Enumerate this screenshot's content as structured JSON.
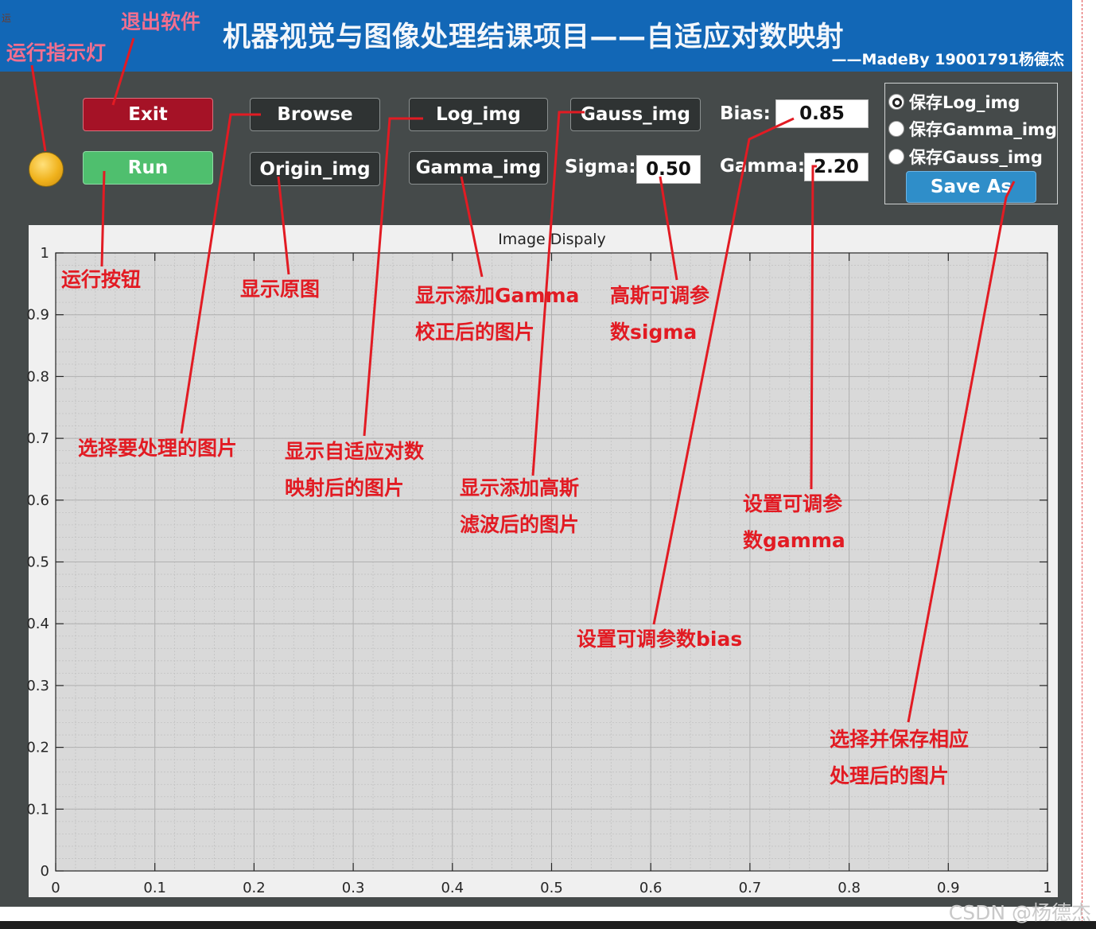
{
  "header": {
    "title": "机器视觉与图像处理结课项目——自适应对数映射",
    "made_by": "——MadeBy 19001791杨德杰",
    "edge_text": "运"
  },
  "controls": {
    "exit_label": "Exit",
    "run_label": "Run",
    "browse_label": "Browse",
    "origin_label": "Origin_img",
    "log_label": "Log_img",
    "gamma_label": "Gamma_img",
    "gauss_label": "Gauss_img",
    "bias_label": "Bias:",
    "bias_value": "0.85",
    "sigma_label": "Sigma:",
    "sigma_value": "0.50",
    "gamma_param_label": "Gamma:",
    "gamma_value": "2.20"
  },
  "save_panel": {
    "options": [
      "保存Log_img",
      "保存Gamma_img",
      "保存Gauss_img"
    ],
    "selected_index": 0,
    "save_label": "Save As"
  },
  "axes": {
    "title": "Image Dispaly",
    "x_ticks": [
      "0",
      "0.1",
      "0.2",
      "0.3",
      "0.4",
      "0.5",
      "0.6",
      "0.7",
      "0.8",
      "0.9",
      "1"
    ],
    "y_ticks": [
      "0",
      "0.1",
      "0.2",
      "0.3",
      "0.4",
      "0.5",
      "0.6",
      "0.7",
      "0.8",
      "0.9",
      "1"
    ],
    "xlim": [
      0,
      1
    ],
    "ylim": [
      0,
      1
    ],
    "grid": true,
    "minor_grid": true
  },
  "annotations": {
    "indicator": "运行指示灯",
    "exit": "退出软件",
    "run": "运行按钮",
    "origin": "显示原图",
    "gamma_line1": "显示添加Gamma",
    "gamma_line2": "校正后的图片",
    "sigma_line1": "高斯可调参",
    "sigma_line2": "数sigma",
    "browse": "选择要处理的图片",
    "log_line1": "显示自适应对数",
    "log_line2": "映射后的图片",
    "gauss_line1": "显示添加高斯",
    "gauss_line2": "滤波后的图片",
    "gammaparam_line1": "设置可调参",
    "gammaparam_line2": "数gamma",
    "bias": "设置可调参数bias",
    "save_line1": "选择并保存相应",
    "save_line2": "处理后的图片"
  },
  "colors": {
    "app_bg": "#454a4a",
    "title_bar": "#1267b6",
    "annotation": "#e21b23",
    "annotation_pink": "#f26f8f",
    "exit_button": "#a51226",
    "run_button": "#4fbf6e",
    "save_button": "#2f8ec9",
    "lamp": "#f0b21c"
  },
  "watermark": "CSDN @杨德杰"
}
